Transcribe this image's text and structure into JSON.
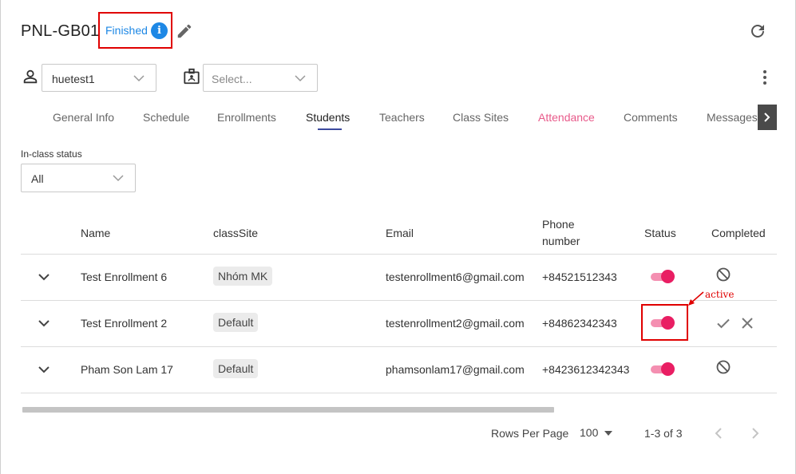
{
  "header": {
    "class_code": "PNL-GB01",
    "status": "Finished",
    "info_glyph": "i"
  },
  "selectors": {
    "user_value": "huetest1",
    "site_placeholder": "Select..."
  },
  "tabs": [
    {
      "label": "General Info"
    },
    {
      "label": "Schedule"
    },
    {
      "label": "Enrollments"
    },
    {
      "label": "Students"
    },
    {
      "label": "Teachers"
    },
    {
      "label": "Class Sites"
    },
    {
      "label": "Attendance"
    },
    {
      "label": "Comments"
    },
    {
      "label": "Messages"
    }
  ],
  "active_tab": "Students",
  "filter": {
    "label": "In-class status",
    "value": "All"
  },
  "table": {
    "columns": {
      "name": "Name",
      "classsite": "classSite",
      "email": "Email",
      "phone_line1": "Phone",
      "phone_line2": "number",
      "status": "Status",
      "completed": "Completed"
    },
    "rows": [
      {
        "name": "Test Enrollment 6",
        "classsite": "Nhóm MK",
        "email": "testenrollment6@gmail.com",
        "phone": "+84521512343",
        "status_active": true,
        "completed_icon": "block-icon"
      },
      {
        "name": "Test Enrollment 2",
        "classsite": "Default",
        "email": "testenrollment2@gmail.com",
        "phone": "+84862342343",
        "status_active": true,
        "completed_icon": "check-and-close-icons"
      },
      {
        "name": "Pham Son Lam 17",
        "classsite": "Default",
        "email": "phamsonlam17@gmail.com",
        "phone": "+8423612342343",
        "status_active": true,
        "completed_icon": "block-icon"
      }
    ]
  },
  "annotation": {
    "label": "active"
  },
  "pagination": {
    "rows_per_page_label": "Rows Per Page",
    "rows_per_page_value": "100",
    "range": "1-3 of 3"
  },
  "colors": {
    "accent_blue": "#1e88e5",
    "toggle_pink": "#e91e63",
    "annotation_red": "#e00000",
    "attendance_tab": "#e85a8a"
  }
}
